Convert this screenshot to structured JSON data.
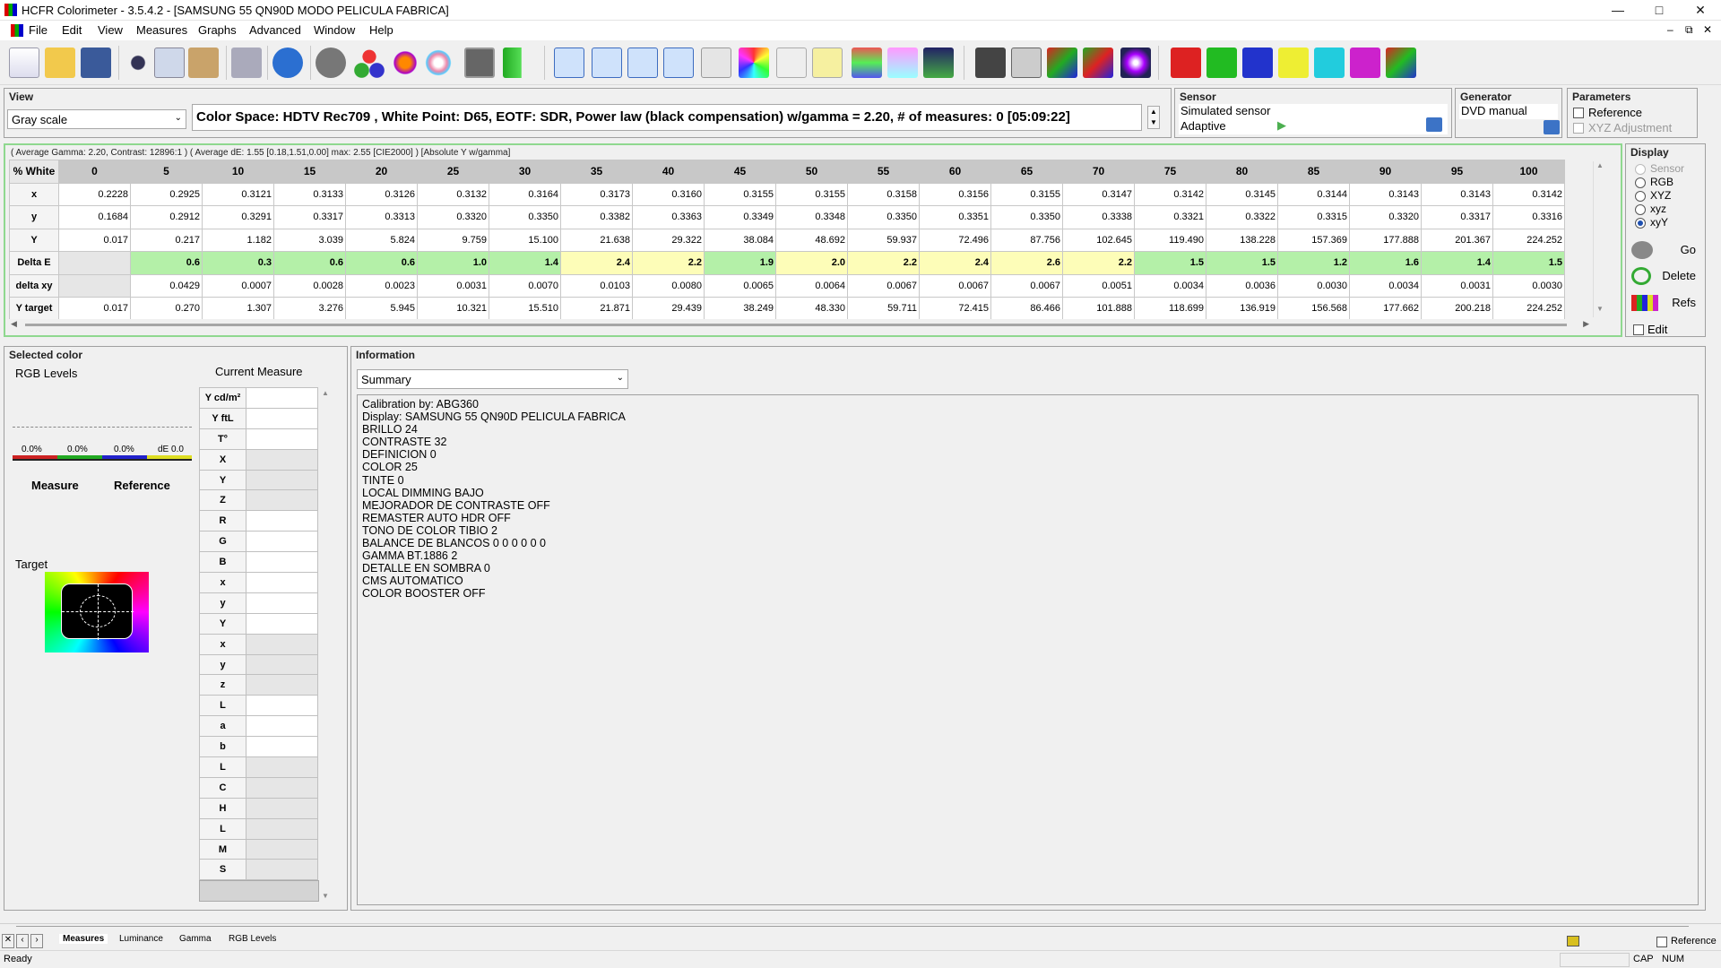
{
  "window": {
    "title": "HCFR Colorimeter - 3.5.4.2 - [SAMSUNG 55 QN90D MODO PELICULA FABRICA]"
  },
  "menu": [
    "File",
    "Edit",
    "View",
    "Measures",
    "Graphs",
    "Advanced",
    "Window",
    "Help"
  ],
  "view": {
    "title": "View",
    "mode": "Gray scale",
    "colorspace": "Color Space: HDTV Rec709 , White Point: D65, EOTF:  SDR, Power law (black compensation) w/gamma = 2.20, # of measures: 0 [05:09:22]"
  },
  "sensor": {
    "title": "Sensor",
    "name": "Simulated sensor",
    "mode": "Adaptive"
  },
  "generator": {
    "title": "Generator",
    "name": "DVD manual"
  },
  "parameters": {
    "title": "Parameters",
    "reference": "Reference",
    "xyz_adj": "XYZ Adjustment"
  },
  "summary_line": "( Average Gamma: 2.20, Contrast: 12896:1 ) ( Average dE: 1.55 [0.18,1.51,0.00] max: 2.55 [CIE2000] ) [Absolute Y w/gamma]",
  "grid": {
    "header_label": "% White",
    "columns": [
      "0",
      "5",
      "10",
      "15",
      "20",
      "25",
      "30",
      "35",
      "40",
      "45",
      "50",
      "55",
      "60",
      "65",
      "70",
      "75",
      "80",
      "85",
      "90",
      "95",
      "100"
    ],
    "rows": [
      {
        "label": "x",
        "values": [
          "0.2228",
          "0.2925",
          "0.3121",
          "0.3133",
          "0.3126",
          "0.3132",
          "0.3164",
          "0.3173",
          "0.3160",
          "0.3155",
          "0.3155",
          "0.3158",
          "0.3156",
          "0.3155",
          "0.3147",
          "0.3142",
          "0.3145",
          "0.3144",
          "0.3143",
          "0.3143",
          "0.3142"
        ]
      },
      {
        "label": "y",
        "values": [
          "0.1684",
          "0.2912",
          "0.3291",
          "0.3317",
          "0.3313",
          "0.3320",
          "0.3350",
          "0.3382",
          "0.3363",
          "0.3349",
          "0.3348",
          "0.3350",
          "0.3351",
          "0.3350",
          "0.3338",
          "0.3321",
          "0.3322",
          "0.3315",
          "0.3320",
          "0.3317",
          "0.3316"
        ]
      },
      {
        "label": "Y",
        "values": [
          "0.017",
          "0.217",
          "1.182",
          "3.039",
          "5.824",
          "9.759",
          "15.100",
          "21.638",
          "29.322",
          "38.084",
          "48.692",
          "59.937",
          "72.496",
          "87.756",
          "102.645",
          "119.490",
          "138.228",
          "157.369",
          "177.888",
          "201.367",
          "224.252"
        ]
      },
      {
        "label": "Delta E",
        "values": [
          "",
          "0.6",
          "0.3",
          "0.6",
          "0.6",
          "1.0",
          "1.4",
          "2.4",
          "2.2",
          "1.9",
          "2.0",
          "2.2",
          "2.4",
          "2.6",
          "2.2",
          "1.5",
          "1.5",
          "1.2",
          "1.6",
          "1.4",
          "1.5"
        ]
      },
      {
        "label": "delta xy",
        "values": [
          "",
          "0.0429",
          "0.0007",
          "0.0028",
          "0.0023",
          "0.0031",
          "0.0070",
          "0.0103",
          "0.0080",
          "0.0065",
          "0.0064",
          "0.0067",
          "0.0067",
          "0.0067",
          "0.0051",
          "0.0034",
          "0.0036",
          "0.0030",
          "0.0034",
          "0.0031",
          "0.0030"
        ]
      },
      {
        "label": "Y target",
        "values": [
          "0.017",
          "0.270",
          "1.307",
          "3.276",
          "5.945",
          "10.321",
          "15.510",
          "21.871",
          "29.439",
          "38.249",
          "48.330",
          "59.711",
          "72.415",
          "86.466",
          "101.888",
          "118.699",
          "136.919",
          "156.568",
          "177.662",
          "200.218",
          "224.252"
        ]
      }
    ]
  },
  "display": {
    "title": "Display",
    "options": [
      "Sensor",
      "RGB",
      "XYZ",
      "xyz",
      "xyY"
    ],
    "selected": "xyY",
    "go": "Go",
    "delete": "Delete",
    "refs": "Refs",
    "edit": "Edit"
  },
  "selected_color": {
    "title": "Selected color",
    "rgb_levels": "RGB Levels",
    "current_measure": "Current Measure",
    "pct": [
      "0.0%",
      "0.0%",
      "0.0%"
    ],
    "de": "dE 0.0",
    "measure": "Measure",
    "reference": "Reference",
    "target": "Target",
    "labels": [
      "Y cd/m²",
      "Y ftL",
      "T°",
      "X",
      "Y",
      "Z",
      "R",
      "G",
      "B",
      "x",
      "y",
      "Y",
      "x",
      "y",
      "z",
      "L",
      "a",
      "b",
      "L",
      "C",
      "H",
      "L",
      "M",
      "S"
    ]
  },
  "information": {
    "title": "Information",
    "select": "Summary",
    "lines": [
      "Calibration by: ABG360",
      "Display: SAMSUNG 55 QN90D PELICULA FABRICA",
      "BRILLO 24",
      "CONTRASTE 32",
      "DEFINICION 0",
      "COLOR 25",
      "TINTE 0",
      "LOCAL DIMMING BAJO",
      "MEJORADOR DE CONTRASTE OFF",
      "REMASTER AUTO HDR OFF",
      "TONO DE COLOR TIBIO 2",
      "BALANCE DE BLANCOS 0 0 0 0 0 0",
      "GAMMA BT.1886 2",
      "DETALLE EN SOMBRA 0",
      "CMS AUTOMATICO",
      "COLOR BOOSTER OFF"
    ]
  },
  "tabs": [
    "Measures",
    "Luminance",
    "Gamma",
    "RGB Levels"
  ],
  "status": {
    "text": "Ready",
    "reference": "Reference",
    "cap": "CAP",
    "num": "NUM"
  }
}
